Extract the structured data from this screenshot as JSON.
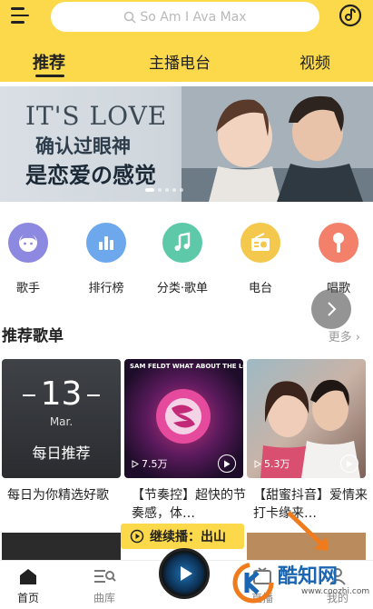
{
  "header": {
    "search_placeholder": "So Am I Ava Max",
    "tabs": [
      {
        "label": "推荐",
        "active": true
      },
      {
        "label": "主播电台",
        "active": false
      },
      {
        "label": "视频",
        "active": false
      }
    ],
    "accent_color": "#fcd94a"
  },
  "banner": {
    "title_en": "IT'S LOVE",
    "line1": "确认过眼神",
    "line2": "是恋爱の感觉"
  },
  "categories": [
    {
      "label": "歌手",
      "icon": "singer-icon",
      "color": "#8d88e0"
    },
    {
      "label": "排行榜",
      "icon": "chart-bars-icon",
      "color": "#6ea8ec"
    },
    {
      "label": "分类·歌单",
      "icon": "music-note-icon",
      "color": "#5dc9a8"
    },
    {
      "label": "电台",
      "icon": "radio-icon",
      "color": "#f4c84c"
    },
    {
      "label": "唱歌",
      "icon": "microphone-icon",
      "color": "#f2806b"
    }
  ],
  "playlists_section": {
    "title": "推荐歌单",
    "more": "更多",
    "cards": [
      {
        "title": "每日为你精选好歌",
        "date_num": "13",
        "date_month": "Mar.",
        "label": "每日推荐"
      },
      {
        "title": "【节奏控】超快的节奏感，体…",
        "plays": "7.5万",
        "cover_text": "SAM FELDT WHAT ABOUT THE LOVE"
      },
      {
        "title": "【甜蜜抖音】爱情来打卡缘来…",
        "plays": "5.3万"
      }
    ]
  },
  "continue_play": {
    "label": "继续播：出山"
  },
  "tabbar": {
    "items": [
      {
        "label": "首页",
        "icon": "home-icon",
        "active": true
      },
      {
        "label": "曲库",
        "icon": "library-icon",
        "active": false
      },
      {
        "label": "直播",
        "icon": "live-icon",
        "active": false
      },
      {
        "label": "我的",
        "icon": "profile-icon",
        "active": false
      }
    ]
  },
  "watermark": {
    "text": "酷知网",
    "url": "www.coozhi.com"
  }
}
